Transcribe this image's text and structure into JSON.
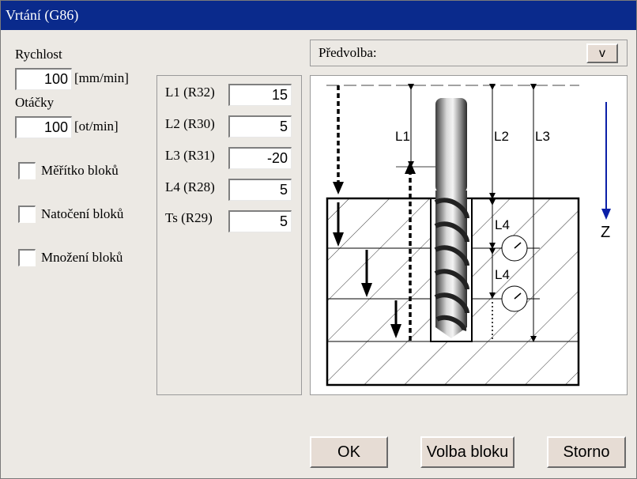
{
  "window": {
    "title": "Vrtání (G86)"
  },
  "speed": {
    "label": "Rychlost",
    "value": "100",
    "unit": "[mm/min]"
  },
  "rpm": {
    "label": "Otáčky",
    "value": "100",
    "unit": "[ot/min]"
  },
  "checkboxes": [
    {
      "label": "Měřítko bloků",
      "checked": false
    },
    {
      "label": "Natočení bloků",
      "checked": false
    },
    {
      "label": "Množení bloků",
      "checked": false
    }
  ],
  "params": [
    {
      "label": "L1 (R32)",
      "value": "15"
    },
    {
      "label": "L2 (R30)",
      "value": "5"
    },
    {
      "label": "L3 (R31)",
      "value": "-20"
    },
    {
      "label": "L4 (R28)",
      "value": "5"
    },
    {
      "label": "Ts (R29)",
      "value": "5"
    }
  ],
  "preset": {
    "label": "Předvolba:",
    "dropdown_label": "v"
  },
  "diagram": {
    "labels": {
      "l1": "L1",
      "l2": "L2",
      "l3": "L3",
      "l4_top": "L4",
      "l4_bottom": "L4",
      "z": "Z"
    },
    "colors": {
      "axis": "#0b1fa8"
    }
  },
  "buttons": {
    "ok": "OK",
    "block_select": "Volba bloku",
    "cancel": "Storno"
  }
}
